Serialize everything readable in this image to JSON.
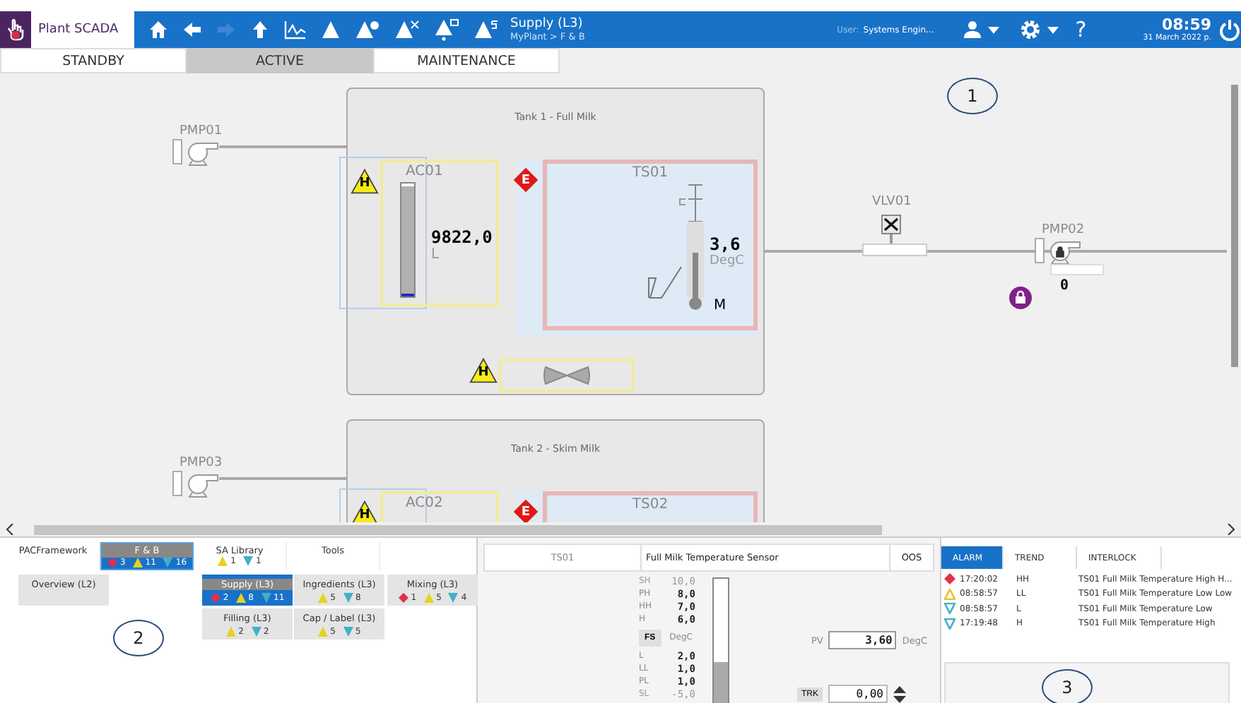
{
  "header": {
    "app_title": "Plant SCADA",
    "nav_title": "Supply (L3)",
    "breadcrumb": "MyPlant > F & B",
    "user_label": "User:",
    "user_name": "Systems Engin...",
    "help": "?",
    "time": "08:59",
    "date": "31 March 2022 р."
  },
  "mode_tabs": [
    {
      "label": "STANDBY",
      "selected": false
    },
    {
      "label": "ACTIVE",
      "selected": true
    },
    {
      "label": "MAINTENANCE",
      "selected": false
    }
  ],
  "canvas": {
    "callout": "1",
    "pumps": [
      {
        "name": "PMP01"
      },
      {
        "name": "PMP02",
        "speed": "0",
        "locked": true
      },
      {
        "name": "PMP03"
      }
    ],
    "valve": {
      "name": "VLV01"
    },
    "tanks": [
      {
        "title": "Tank 1 - Full Milk",
        "level_indicator": {
          "name": "AC01",
          "value": "9822,0",
          "unit": "L",
          "level": 0.98,
          "badge": {
            "kind": "warning",
            "letter": "H"
          }
        },
        "temp_indicator": {
          "name": "TS01",
          "value": "3,6",
          "unit": "DegC",
          "mode": "M",
          "badge": {
            "kind": "error",
            "letter": "E"
          }
        },
        "agitator": {
          "badge": {
            "kind": "warning",
            "letter": "H"
          }
        }
      },
      {
        "title": "Tank 2 - Skim Milk",
        "level_indicator": {
          "name": "AC02",
          "badge": {
            "kind": "warning",
            "letter": "H"
          }
        },
        "temp_indicator": {
          "name": "TS02",
          "badge": {
            "kind": "error",
            "letter": "E"
          }
        }
      }
    ]
  },
  "navigation": {
    "callout": "2",
    "tabs": [
      {
        "label": "PACFramework",
        "selected": false
      },
      {
        "label": "F & B",
        "selected": true,
        "counts": [
          {
            "kind": "diamond",
            "color": "#e0304a",
            "value": "3"
          },
          {
            "kind": "up",
            "color": "#e8d020",
            "value": "11"
          },
          {
            "kind": "down",
            "color": "#40b0c8",
            "value": "16"
          }
        ]
      },
      {
        "label": "SA Library",
        "selected": false,
        "counts": [
          {
            "kind": "up",
            "color": "#e8d020",
            "value": "1"
          },
          {
            "kind": "down",
            "color": "#40b0c8",
            "value": "1"
          }
        ]
      },
      {
        "label": "Tools",
        "selected": false
      }
    ],
    "overview": {
      "label": "Overview (L2)",
      "selected": false
    },
    "areas": [
      {
        "label": "Supply (L3)",
        "selected": true,
        "counts": [
          {
            "kind": "diamond",
            "color": "#e0304a",
            "value": "2"
          },
          {
            "kind": "up",
            "color": "#e8d020",
            "value": "8"
          },
          {
            "kind": "down",
            "color": "#40b0c8",
            "value": "11"
          }
        ]
      },
      {
        "label": "Ingredients (L3)",
        "selected": false,
        "counts": [
          {
            "kind": "up",
            "color": "#e8d020",
            "value": "5"
          },
          {
            "kind": "down",
            "color": "#40b0c8",
            "value": "8"
          }
        ]
      },
      {
        "label": "Mixing (L3)",
        "selected": false,
        "counts": [
          {
            "kind": "diamond",
            "color": "#e0304a",
            "value": "1"
          },
          {
            "kind": "up",
            "color": "#e8d020",
            "value": "5"
          },
          {
            "kind": "down",
            "color": "#40b0c8",
            "value": "4"
          }
        ]
      },
      {
        "label": "Filling (L3)",
        "selected": false,
        "counts": [
          {
            "kind": "up",
            "color": "#e8d020",
            "value": "2"
          },
          {
            "kind": "down",
            "color": "#40b0c8",
            "value": "2"
          }
        ]
      },
      {
        "label": "Cap / Label (L3)",
        "selected": false,
        "counts": [
          {
            "kind": "up",
            "color": "#e8d020",
            "value": "5"
          },
          {
            "kind": "down",
            "color": "#40b0c8",
            "value": "5"
          }
        ]
      }
    ]
  },
  "faceplate": {
    "tag": "TS01",
    "description": "Full Milk Temperature Sensor",
    "status": "OOS",
    "upper_limits": [
      {
        "label": "SH",
        "value": "10,0",
        "enabled": false
      },
      {
        "label": "PH",
        "value": "8,0",
        "enabled": true
      },
      {
        "label": "HH",
        "value": "7,0",
        "enabled": true
      },
      {
        "label": "H",
        "value": "6,0",
        "enabled": true
      }
    ],
    "scale_button": "FS",
    "unit": "DegC",
    "lower_limits": [
      {
        "label": "L",
        "value": "2,0",
        "enabled": true
      },
      {
        "label": "LL",
        "value": "1,0",
        "enabled": true
      },
      {
        "label": "PL",
        "value": "1,0",
        "enabled": true
      },
      {
        "label": "SL",
        "value": "-5,0",
        "enabled": false
      }
    ],
    "level": 0.33,
    "pv_label": "PV",
    "pv_value": "3,60",
    "pv_unit": "DegC",
    "track_button": "TRK",
    "track_value": "0,00"
  },
  "alarm_panel": {
    "callout": "3",
    "tabs": [
      {
        "label": "ALARM",
        "selected": true
      },
      {
        "label": "TREND",
        "selected": false
      },
      {
        "label": "INTERLOCK",
        "selected": false
      }
    ],
    "alarms": [
      {
        "kind": "diamond",
        "color": "#e0304a",
        "time": "17:20:02",
        "limit": "HH",
        "message": "TS01 Full Milk Temperature High H..."
      },
      {
        "kind": "up",
        "color": "#e8c020",
        "time": "08:58:57",
        "limit": "LL",
        "message": "TS01 Full Milk Temperature Low Low"
      },
      {
        "kind": "down",
        "color": "#40b0c8",
        "time": "08:58:57",
        "limit": "L",
        "message": "TS01 Full Milk Temperature Low"
      },
      {
        "kind": "down",
        "color": "#40b0c8",
        "time": "17:19:48",
        "limit": "H",
        "message": "TS01 Full Milk Temperature High"
      }
    ]
  }
}
